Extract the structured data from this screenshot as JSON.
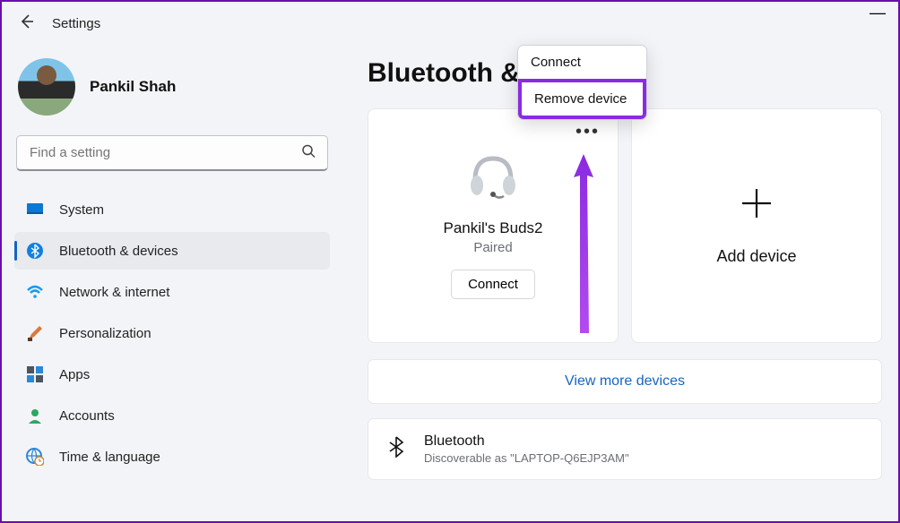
{
  "window": {
    "app_title": "Settings",
    "minimize": "—"
  },
  "profile": {
    "name": "Pankil Shah"
  },
  "search": {
    "placeholder": "Find a setting"
  },
  "nav": {
    "items": [
      {
        "label": "System"
      },
      {
        "label": "Bluetooth & devices"
      },
      {
        "label": "Network & internet"
      },
      {
        "label": "Personalization"
      },
      {
        "label": "Apps"
      },
      {
        "label": "Accounts"
      },
      {
        "label": "Time & language"
      }
    ]
  },
  "page": {
    "title": "Bluetooth &"
  },
  "device": {
    "name": "Pankil's Buds2",
    "status": "Paired",
    "connect_label": "Connect"
  },
  "add": {
    "label": "Add device"
  },
  "view_more": {
    "label": "View more devices"
  },
  "bluetooth_row": {
    "title": "Bluetooth",
    "subtitle": "Discoverable as \"LAPTOP-Q6EJP3AM\""
  },
  "context": {
    "connect": "Connect",
    "remove": "Remove device"
  },
  "colors": {
    "accent": "#1665c1",
    "highlight": "#8a2be2"
  }
}
